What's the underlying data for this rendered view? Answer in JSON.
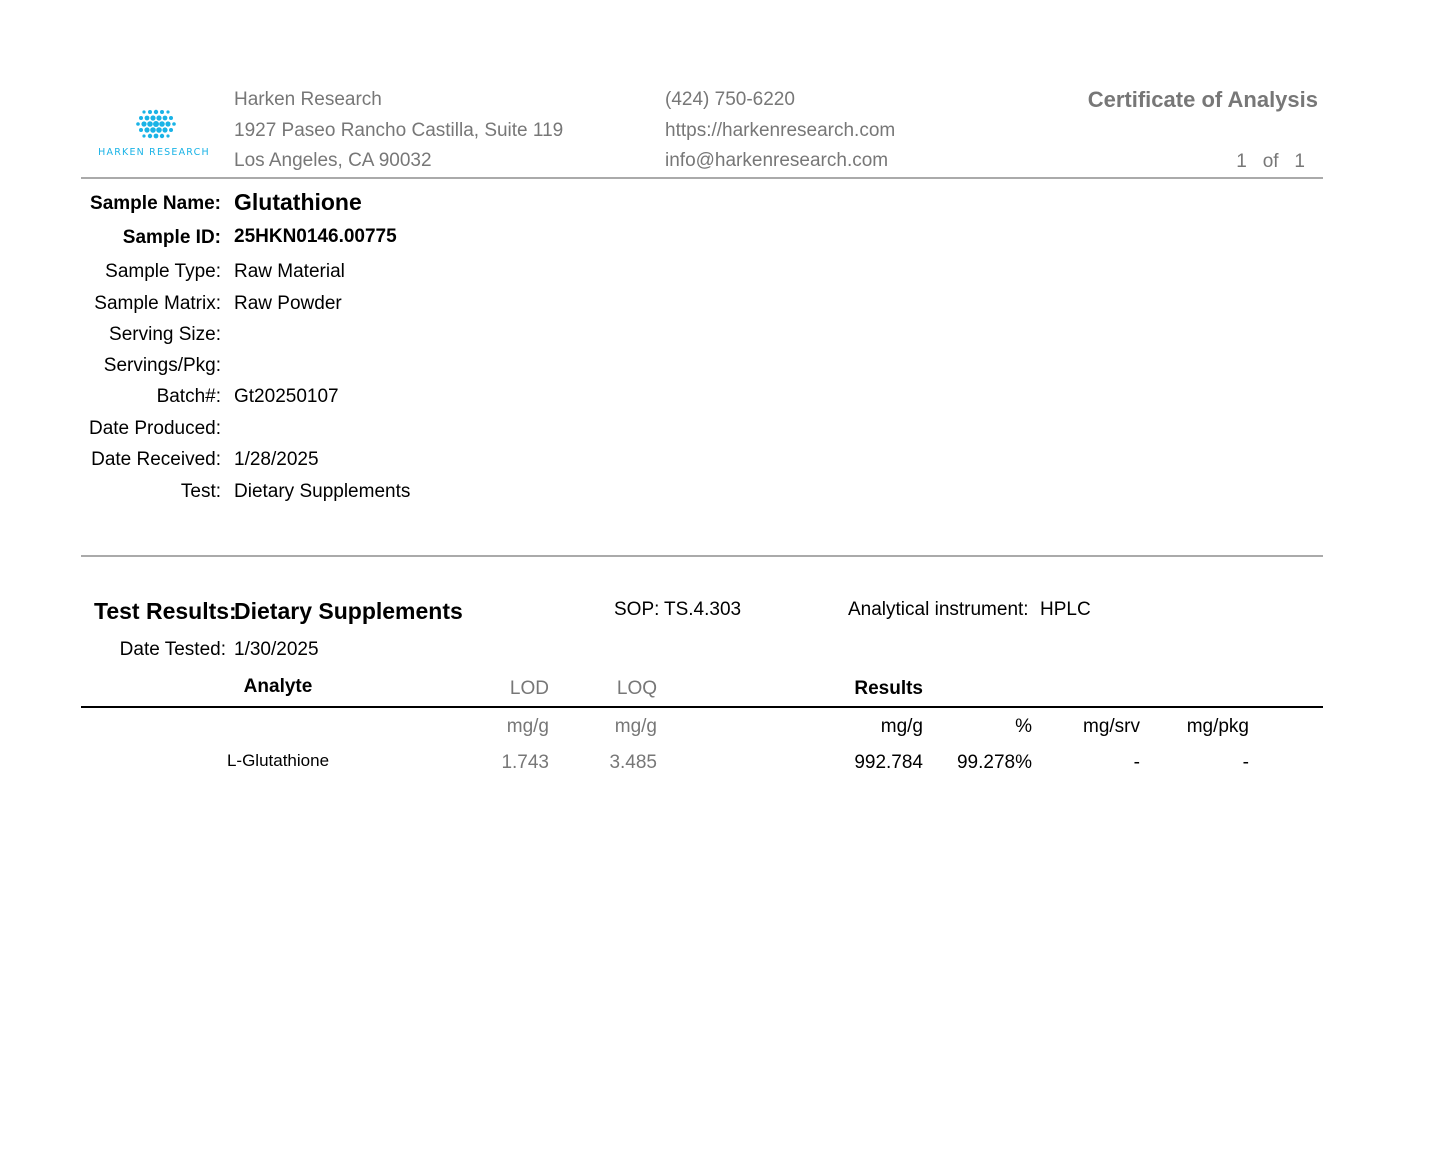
{
  "lab": {
    "logo_text": "HARKEN RESEARCH",
    "name": "Harken Research",
    "address1": "1927 Paseo Rancho Castilla, Suite 119",
    "address2": "Los Angeles, CA 90032",
    "phone": "(424) 750-6220",
    "website": "https://harkenresearch.com",
    "email": "info@harkenresearch.com",
    "brand_color": "#1ab3e6"
  },
  "doc": {
    "title": "Certificate of Analysis",
    "page_current": "1",
    "page_of": "of",
    "page_total": "1"
  },
  "sample": {
    "fields": [
      {
        "label": "Sample Name:",
        "value": "Glutathione"
      },
      {
        "label": "Sample ID:",
        "value": "25HKN0146.00775"
      },
      {
        "label": "Sample Type:",
        "value": "Raw Material"
      },
      {
        "label": "Sample Matrix:",
        "value": "Raw Powder"
      },
      {
        "label": "Serving Size:",
        "value": ""
      },
      {
        "label": "Servings/Pkg:",
        "value": ""
      },
      {
        "label": "Batch#:",
        "value": "Gt20250107"
      },
      {
        "label": "Date Produced:",
        "value": ""
      },
      {
        "label": "Date Received:",
        "value": "1/28/2025"
      },
      {
        "label": "Test:",
        "value": "Dietary Supplements"
      }
    ]
  },
  "results": {
    "heading_label": "Test Results:",
    "heading_value": "Dietary Supplements",
    "sop_label": "SOP:",
    "sop_value": "TS.4.303",
    "instrument_label": "Analytical instrument:",
    "instrument_value": "HPLC",
    "date_tested_label": "Date Tested:",
    "date_tested_value": "1/30/2025",
    "columns": {
      "analyte": "Analyte",
      "lod": "LOD",
      "loq": "LOQ",
      "results": "Results"
    },
    "units": {
      "lod": "mg/g",
      "loq": "mg/g",
      "res_mgg": "mg/g",
      "res_pct": "%",
      "res_mgsrv": "mg/srv",
      "res_mgpkg": "mg/pkg"
    },
    "rows": [
      {
        "analyte": "L-Glutathione",
        "lod": "1.743",
        "loq": "3.485",
        "mgg": "992.784",
        "pct": "99.278%",
        "mgsrv": "-",
        "mgpkg": "-"
      }
    ]
  }
}
